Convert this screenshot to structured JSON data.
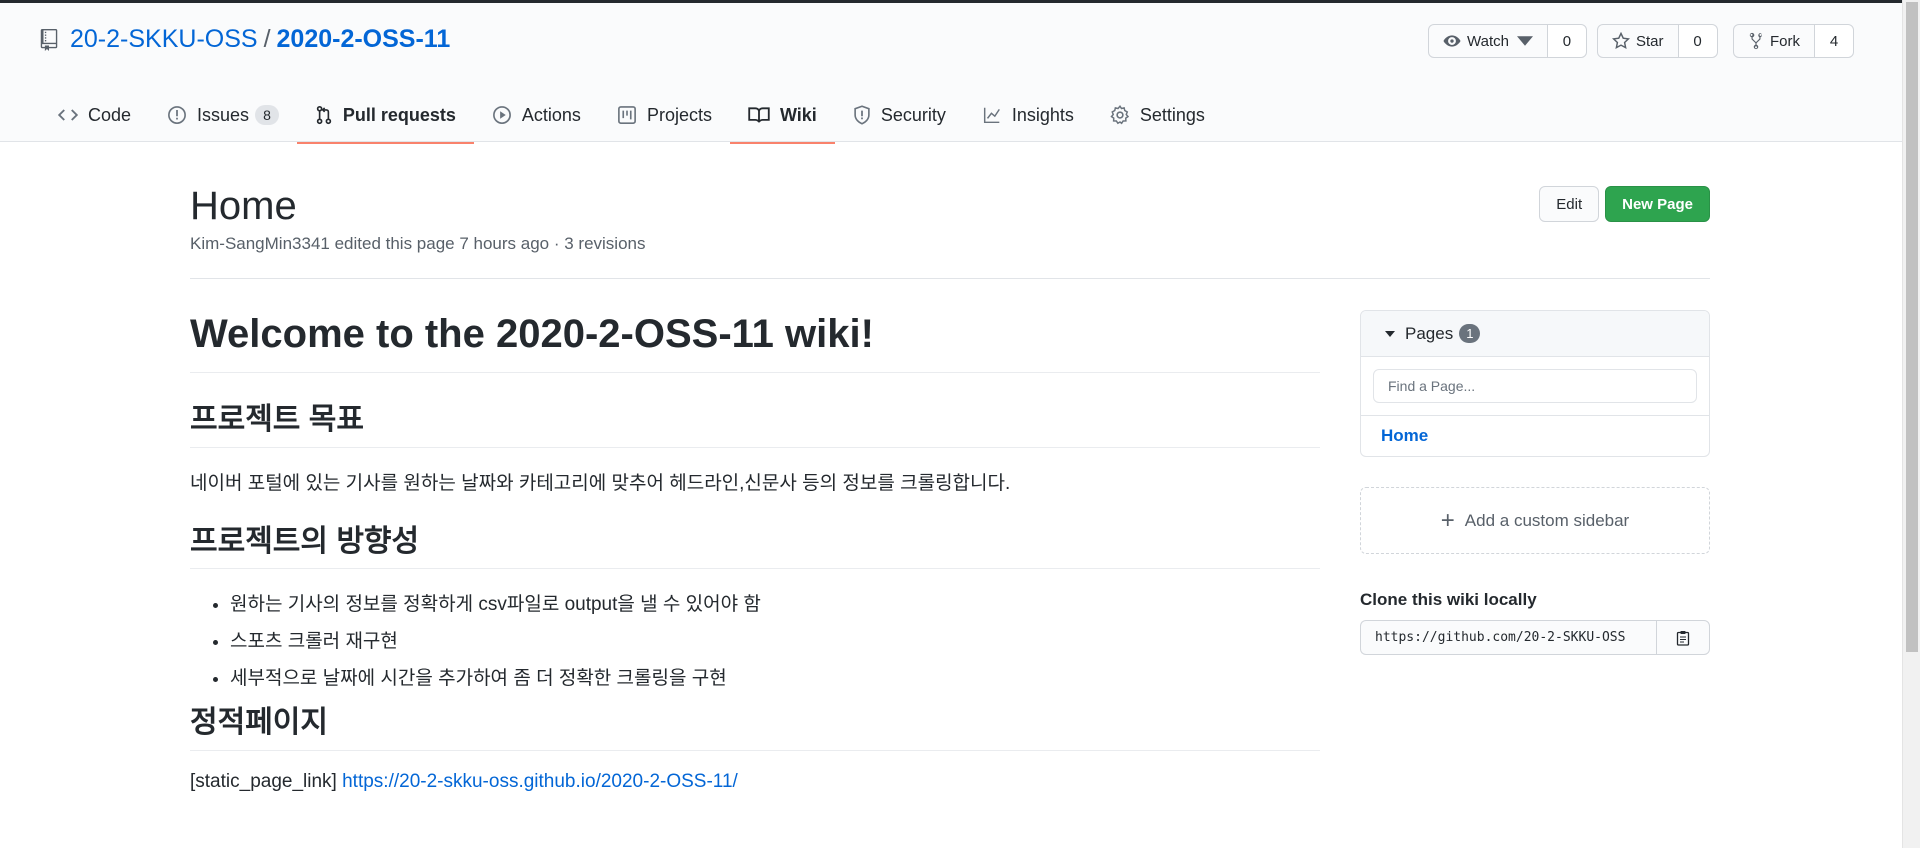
{
  "repo": {
    "owner": "20-2-SKKU-OSS",
    "separator": "/",
    "name": "2020-2-OSS-11"
  },
  "actions": {
    "watch_label": "Watch",
    "watch_count": "0",
    "star_label": "Star",
    "star_count": "0",
    "fork_label": "Fork",
    "fork_count": "4"
  },
  "nav": {
    "code": "Code",
    "issues": "Issues",
    "issues_count": "8",
    "pull_requests": "Pull requests",
    "actions": "Actions",
    "projects": "Projects",
    "wiki": "Wiki",
    "security": "Security",
    "insights": "Insights",
    "settings": "Settings"
  },
  "wiki": {
    "title": "Home",
    "meta": "Kim-SangMin3341 edited this page 7 hours ago · 3 revisions",
    "edit_label": "Edit",
    "new_page_label": "New Page"
  },
  "content": {
    "h1": "Welcome to the 2020-2-OSS-11 wiki!",
    "h2_goal": "프로젝트 목표",
    "goal_text": "네이버 포털에 있는 기사를 원하는 날짜와 카테고리에 맞추어 헤드라인,신문사 등의 정보를 크롤링합니다.",
    "h2_direction": "프로젝트의 방향성",
    "direction_items": [
      "원하는 기사의 정보를 정확하게 csv파일로 output을 낼 수 있어야 함",
      "스포츠 크롤러 재구현",
      "세부적으로 날짜에 시간을 추가하여 좀 더 정확한 크롤링을 구현"
    ],
    "h2_static": "정적페이지",
    "static_prefix": "[static_page_link]",
    "static_link": "https://20-2-skku-oss.github.io/2020-2-OSS-11/"
  },
  "sidebar": {
    "pages_label": "Pages",
    "pages_count": "1",
    "find_placeholder": "Find a Page...",
    "pages": [
      "Home"
    ],
    "add_sidebar_label": "Add a custom sidebar",
    "clone_title": "Clone this wiki locally",
    "clone_url": "https://github.com/20-2-SKKU-OSS"
  },
  "colors": {
    "link": "#0366d6",
    "new_page_button": "#2ea44f",
    "nav_underline": "#f9826c"
  },
  "icons": [
    "repo-icon",
    "eye-icon",
    "caret-down-icon",
    "star-icon",
    "fork-icon",
    "code-icon",
    "issue-icon",
    "pull-request-icon",
    "play-icon",
    "project-icon",
    "book-icon",
    "shield-icon",
    "graph-icon",
    "gear-icon",
    "plus-icon",
    "clipboard-icon"
  ]
}
